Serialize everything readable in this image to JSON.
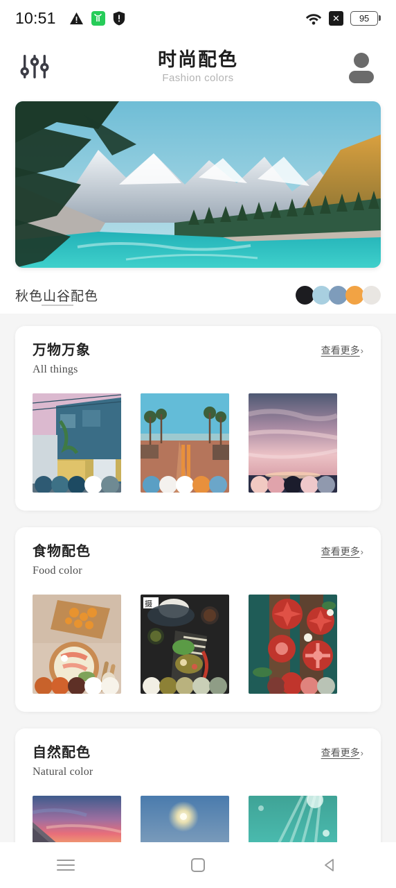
{
  "status_bar": {
    "time": "10:51",
    "left_icons": [
      "warning-triangle-icon",
      "green-app-icon",
      "shield-alert-icon"
    ],
    "right_icons": [
      "wifi-icon",
      "x-badge-icon"
    ],
    "battery_level": "95"
  },
  "app_bar": {
    "settings_icon": "sliders-icon",
    "title_cn": "时尚配色",
    "title_en": "Fashion colors",
    "avatar_icon": "avatar-icon"
  },
  "hero": {
    "label": "秋色山谷配色",
    "image_alt": "mountain-lake-photo",
    "swatches": [
      "#1c1c20",
      "#a8cfe0",
      "#7e9cbb",
      "#f2a344",
      "#e9e6e2"
    ]
  },
  "sections": [
    {
      "title_cn": "万物万象",
      "title_en": "All things",
      "more_label": "查看更多",
      "more_chevron": "chevron-right-icon",
      "thumb_shape": "tall",
      "items": [
        {
          "alt": "blue-house-storefront-photo",
          "swatches": [
            "#2e5a73",
            "#3d7186",
            "#1d4a62",
            "#ffffff",
            "#6f8a93"
          ]
        },
        {
          "alt": "palm-street-sunset-photo",
          "swatches": [
            "#5a9fc4",
            "#f4f1ee",
            "#ffffff",
            "#e8903c",
            "#6ba6c9"
          ]
        },
        {
          "alt": "pink-sky-sunset-photo",
          "swatches": [
            "#f1c9c2",
            "#e0a3ab",
            "#1b1c2c",
            "#efc8ca",
            "#9099ae"
          ]
        }
      ]
    },
    {
      "title_cn": "食物配色",
      "title_en": "Food color",
      "more_label": "查看更多",
      "more_chevron": "chevron-right-icon",
      "thumb_shape": "tall",
      "items": [
        {
          "alt": "sushi-platter-photo",
          "swatches": [
            "#c8622b",
            "#d2622c",
            "#5e3026",
            "#ffffff",
            "#f7f3ea"
          ]
        },
        {
          "alt": "dark-table-salad-photo",
          "swatches": [
            "#f2efe4",
            "#8d8136",
            "#b9b27e",
            "#c9cfb7",
            "#8f9d86"
          ]
        },
        {
          "alt": "strawberry-tarts-photo",
          "swatches": [
            "#1f5c57",
            "#7d3a33",
            "#c0352c",
            "#e0837d",
            "#b9c3b5"
          ]
        }
      ]
    },
    {
      "title_cn": "自然配色",
      "title_en": "Natural color",
      "more_label": "查看更多",
      "more_chevron": "chevron-right-icon",
      "thumb_shape": "wide",
      "items": [
        {
          "alt": "pink-dusk-sky-photo",
          "swatches": []
        },
        {
          "alt": "moon-blue-sky-photo",
          "swatches": []
        },
        {
          "alt": "underwater-sunrays-photo",
          "swatches": []
        }
      ]
    }
  ],
  "nav_bar": {
    "recents": "recents-icon",
    "home": "home-icon",
    "back": "back-icon"
  }
}
